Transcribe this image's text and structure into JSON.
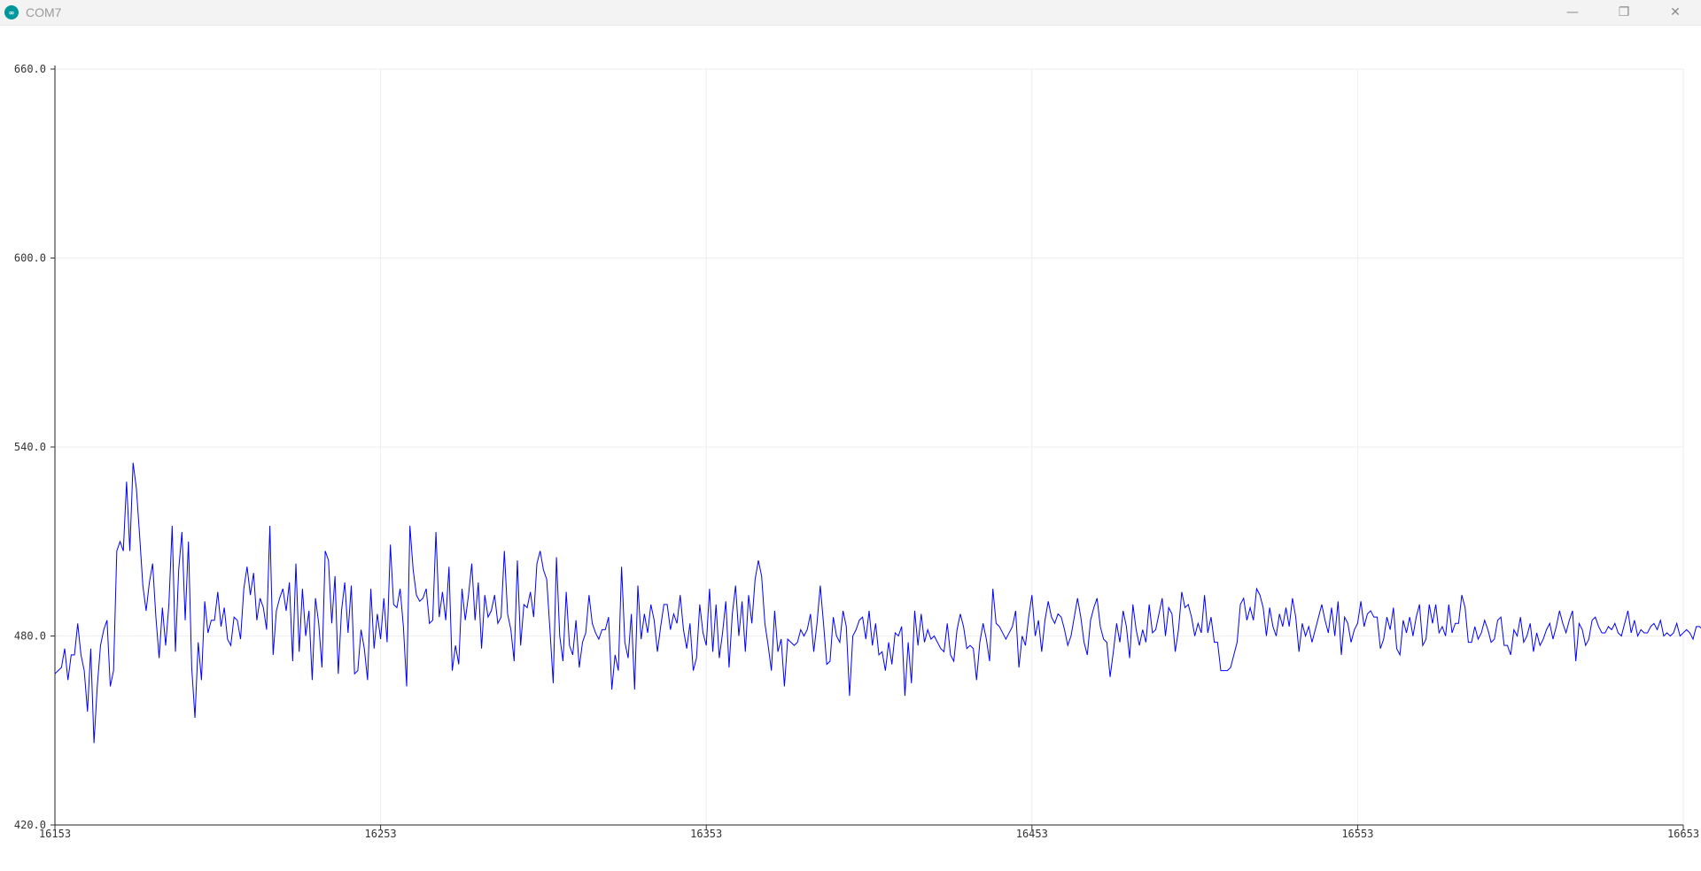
{
  "window": {
    "title": "COM7",
    "icon": "arduino-logo-icon",
    "controls": {
      "minimize_icon": "minimize-icon",
      "restore_icon": "restore-icon",
      "close_icon": "close-icon"
    }
  },
  "chart_data": {
    "type": "line",
    "title": "",
    "xlabel": "",
    "ylabel": "",
    "xlim": [
      16153,
      16653
    ],
    "ylim": [
      420,
      660
    ],
    "x_ticks": [
      "16153",
      "16253",
      "16353",
      "16453",
      "16553",
      "16653"
    ],
    "y_ticks": [
      "420.0",
      "480.0",
      "540.0",
      "600.0",
      "660.0"
    ],
    "grid": true,
    "line_color": "#0000ff",
    "grid_color": "#eeeeee",
    "series": [
      {
        "x_start": 16153,
        "x_step": 1,
        "values": [
          468,
          469,
          470,
          476,
          466,
          474,
          474,
          484,
          474,
          469,
          456,
          476,
          446,
          464,
          477,
          482,
          485,
          464,
          469,
          507,
          510,
          507,
          529,
          507,
          535,
          527,
          512,
          496,
          488,
          497,
          503,
          486,
          473,
          489,
          477,
          490,
          515,
          475,
          501,
          513,
          485,
          510,
          470,
          454,
          478,
          466,
          491,
          481,
          485,
          485,
          494,
          483,
          489,
          479,
          477,
          486,
          485,
          479,
          495,
          502,
          493,
          500,
          485,
          492,
          489,
          482,
          515,
          474,
          488,
          492,
          495,
          488,
          497,
          472,
          503,
          475,
          495,
          480,
          488,
          466,
          492,
          484,
          470,
          507,
          504,
          484,
          499,
          468,
          488,
          497,
          481,
          496,
          468,
          469,
          482,
          476,
          466,
          495,
          476,
          487,
          479,
          492,
          478,
          509,
          490,
          489,
          495,
          483,
          464,
          515,
          501,
          493,
          491,
          492,
          495,
          484,
          485,
          513,
          486,
          494,
          485,
          502,
          469,
          477,
          471,
          495,
          485,
          493,
          503,
          485,
          497,
          476,
          493,
          486,
          488,
          493,
          484,
          486,
          507,
          487,
          482,
          472,
          504,
          477,
          490,
          489,
          494,
          486,
          503,
          507,
          501,
          498,
          482,
          465,
          505,
          480,
          472,
          494,
          477,
          474,
          485,
          470,
          478,
          481,
          493,
          484,
          481,
          479,
          482,
          482,
          486,
          463,
          474,
          469,
          502,
          478,
          473,
          487,
          463,
          496,
          479,
          487,
          481,
          490,
          485,
          475,
          483,
          490,
          490,
          482,
          487,
          484,
          493,
          482,
          476,
          484,
          469,
          473,
          490,
          481,
          477,
          495,
          475,
          490,
          473,
          481,
          491,
          470,
          487,
          496,
          480,
          491,
          475,
          493,
          484,
          498,
          504,
          499,
          484,
          477,
          469,
          488,
          475,
          479,
          464,
          479,
          478,
          477,
          478,
          482,
          480,
          482,
          487,
          475,
          484,
          496,
          484,
          471,
          472,
          486,
          480,
          478,
          488,
          483,
          461,
          480,
          482,
          485,
          486,
          479,
          488,
          477,
          484,
          474,
          475,
          469,
          478,
          471,
          481,
          480,
          483,
          461,
          478,
          465,
          488,
          477,
          487,
          478,
          482,
          479,
          480,
          478,
          476,
          475,
          484,
          474,
          472,
          482,
          487,
          483,
          476,
          477,
          476,
          466,
          478,
          484,
          479,
          472,
          495,
          484,
          483,
          481,
          479,
          481,
          483,
          488,
          470,
          480,
          477,
          486,
          493,
          480,
          485,
          475,
          485,
          491,
          486,
          484,
          487,
          486,
          482,
          477,
          480,
          486,
          492,
          486,
          478,
          474,
          485,
          489,
          492,
          483,
          479,
          478,
          467,
          475,
          484,
          478,
          488,
          483,
          473,
          490,
          482,
          477,
          482,
          478,
          490,
          481,
          482,
          487,
          492,
          480,
          489,
          487,
          475,
          482,
          494,
          489,
          490,
          486,
          480,
          484,
          481,
          493,
          481,
          486,
          478,
          478,
          469,
          469,
          469,
          470,
          474,
          478,
          490,
          492,
          485,
          489,
          485,
          495,
          493,
          489,
          480,
          489,
          483,
          480,
          487,
          483,
          489,
          483,
          492,
          486,
          475,
          484,
          480,
          483,
          478,
          482,
          486,
          490,
          485,
          481,
          489,
          480,
          491,
          474,
          486,
          484,
          478,
          482,
          484,
          491,
          483,
          487,
          488,
          486,
          486,
          476,
          479,
          486,
          482,
          489,
          476,
          474,
          485,
          481,
          486,
          480,
          486,
          490,
          477,
          479,
          490,
          484,
          490,
          481,
          483,
          480,
          490,
          481,
          484,
          484,
          493,
          489,
          478,
          478,
          483,
          479,
          481,
          485,
          482,
          478,
          479,
          485,
          486,
          477,
          477,
          474,
          482,
          480,
          486,
          478,
          480,
          484,
          475,
          481,
          477,
          479,
          482,
          484,
          479,
          483,
          488,
          484,
          481,
          485,
          488,
          472,
          484,
          482,
          477,
          479,
          485,
          486,
          483,
          481,
          481,
          483,
          482,
          484,
          481,
          480,
          484,
          488,
          481,
          485,
          480,
          482,
          481,
          481,
          483,
          484,
          482,
          485,
          480,
          481,
          480,
          481,
          484,
          480,
          481,
          482,
          481,
          479,
          483,
          483,
          482,
          481,
          481,
          481,
          482,
          480,
          480,
          482,
          482,
          480
        ]
      }
    ]
  }
}
